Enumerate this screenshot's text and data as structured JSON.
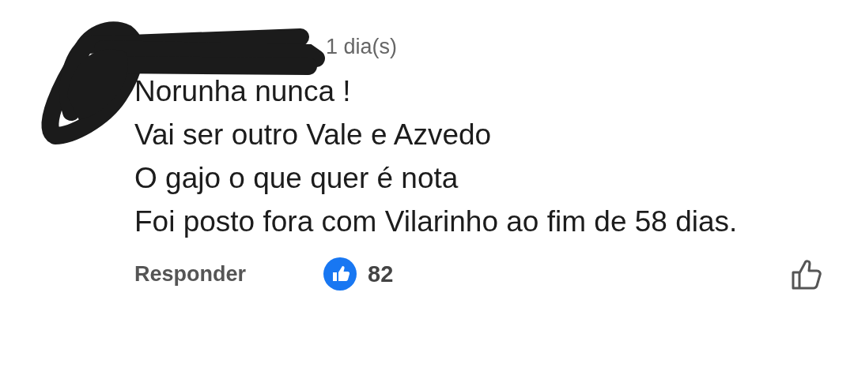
{
  "comment": {
    "time": "1 dia(s)",
    "lines": [
      "Norunha nunca !",
      "Vai ser outro Vale e Azvedo",
      "O gajo o que quer é nota",
      "Foi posto fora com Vilarinho ao fim de 58 dias."
    ],
    "reply": "Responder",
    "likes": "82"
  }
}
